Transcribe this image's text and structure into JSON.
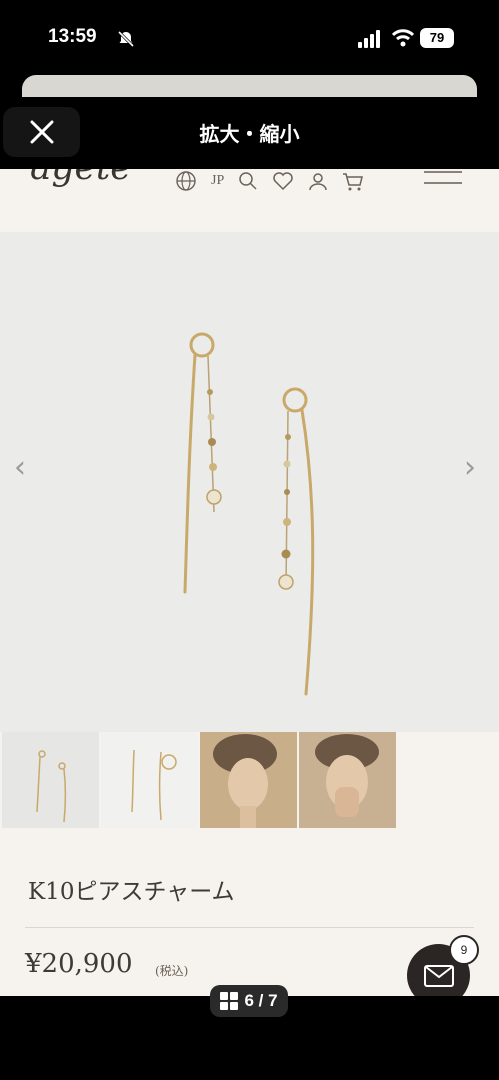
{
  "status": {
    "time": "13:59",
    "battery": "79"
  },
  "nav": {
    "title": "拡大・縮小"
  },
  "site": {
    "logo": "agete",
    "lang": "JP"
  },
  "product": {
    "name": "K10ピアスチャーム",
    "price": "¥20,900",
    "tax": "(税込)"
  },
  "thumbnails": [
    {
      "label": "earrings-flat"
    },
    {
      "label": "earrings-hook"
    },
    {
      "label": "model-side"
    },
    {
      "label": "model-hand"
    }
  ],
  "fab": {
    "badge": "9"
  },
  "pager": {
    "text": "6 / 7"
  },
  "colors": {
    "accent": "#2b2623",
    "background": "#f6f3ee",
    "gold": "#c8a96a"
  }
}
